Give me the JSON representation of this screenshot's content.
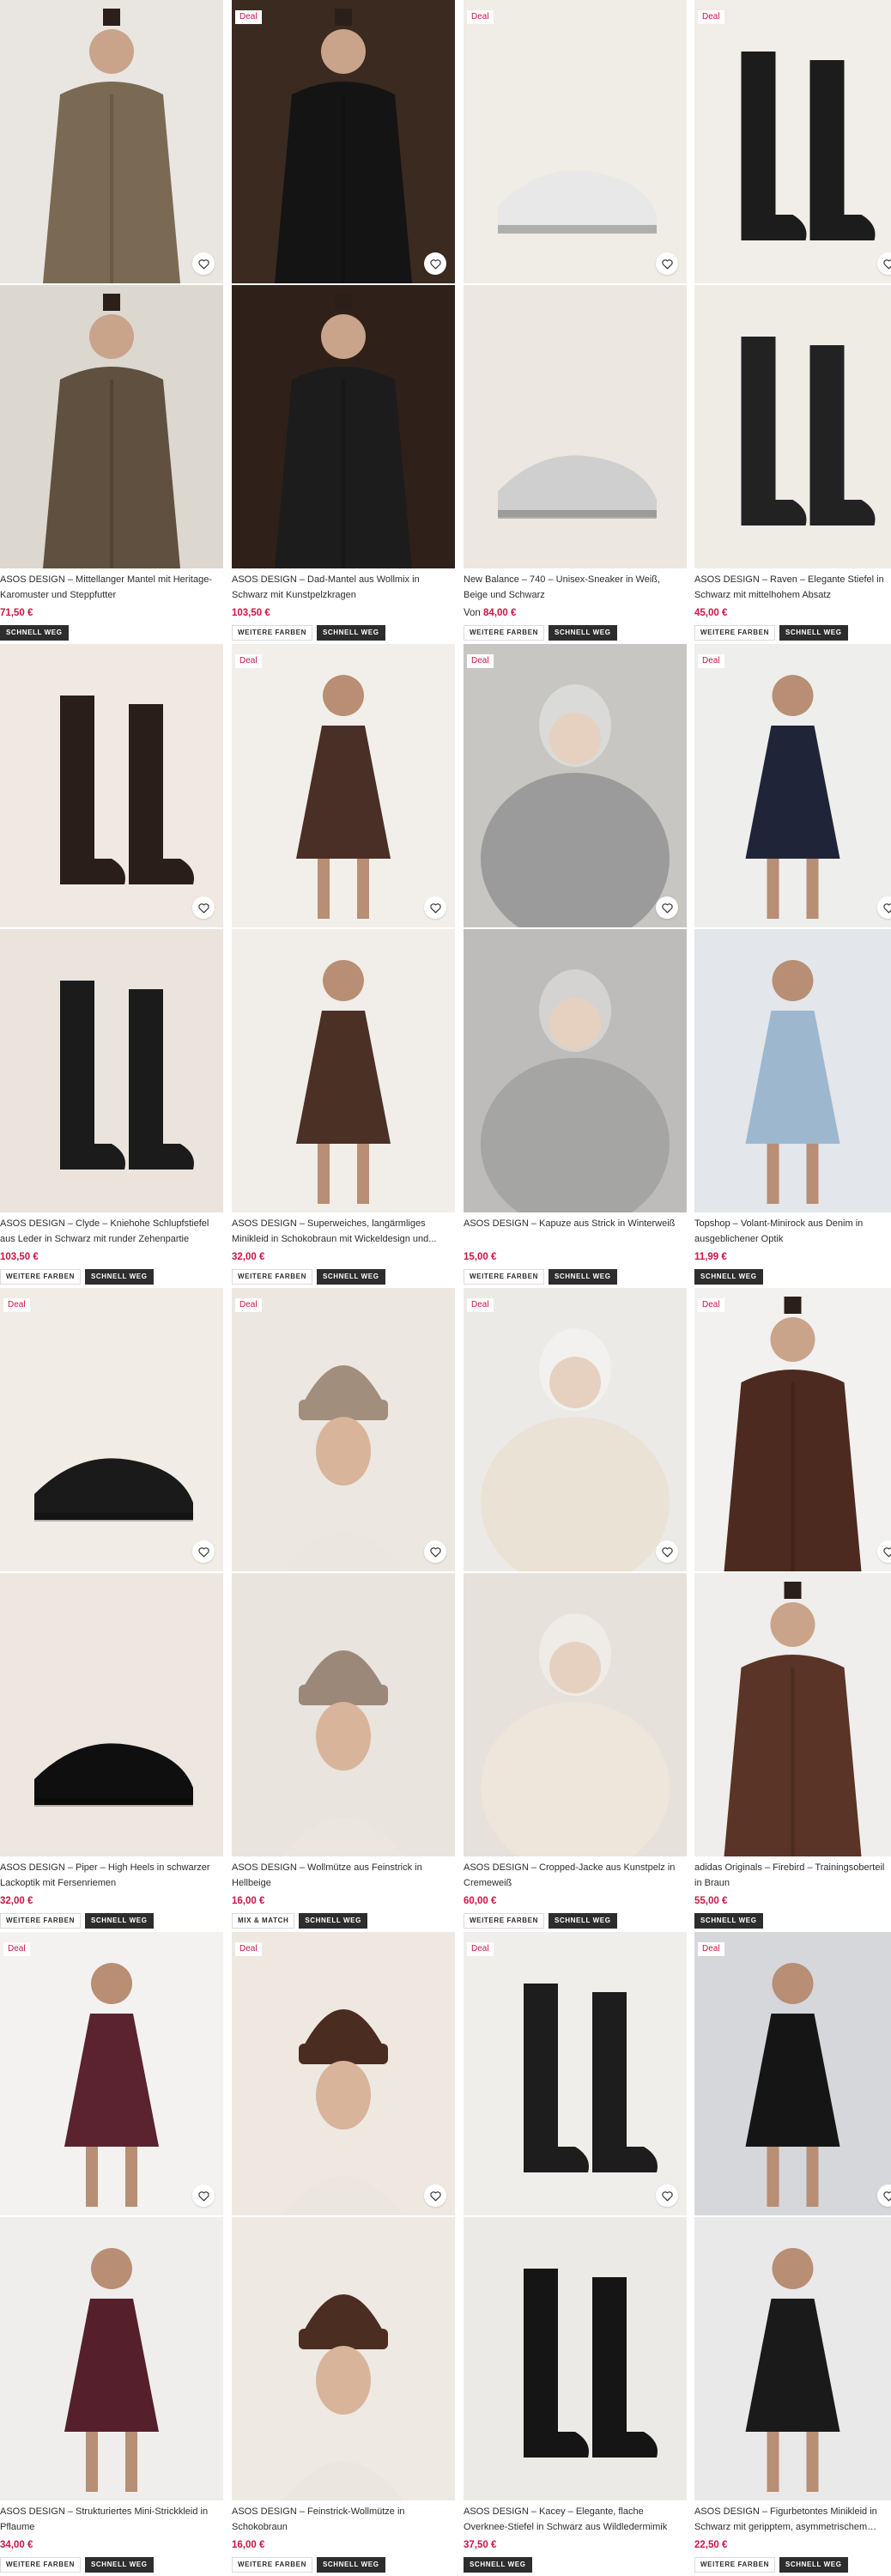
{
  "colors": {
    "deal": "#d01345",
    "price": "#d01345",
    "tag_dark": "#2d2d2d"
  },
  "products": [
    {
      "title": "ASOS DESIGN – Mittellanger Mantel mit Heritage-Karomuster und Steppfutter",
      "price": "71,50 €",
      "price_prefix": "",
      "deal": "",
      "tags": [
        "SCHNELL WEG"
      ],
      "icon": "heart-icon"
    },
    {
      "title": "ASOS DESIGN – Dad-Mantel aus Wollmix in Schwarz mit Kunstpelzkragen",
      "price": "103,50 €",
      "price_prefix": "",
      "deal": "Deal",
      "tags": [
        "WEITERE FARBEN",
        "SCHNELL WEG"
      ],
      "icon": "heart-icon"
    },
    {
      "title": "New Balance – 740 – Unisex-Sneaker in Weiß, Beige und Schwarz",
      "price": "84,00 €",
      "price_prefix": "Von",
      "deal": "Deal",
      "tags": [
        "WEITERE FARBEN",
        "SCHNELL WEG"
      ],
      "icon": "heart-icon"
    },
    {
      "title": "ASOS DESIGN – Raven – Elegante Stiefel in Schwarz mit mittelhohem Absatz",
      "price": "45,00 €",
      "price_prefix": "",
      "deal": "Deal",
      "tags": [
        "WEITERE FARBEN",
        "SCHNELL WEG"
      ],
      "icon": "heart-icon"
    },
    {
      "title": "ASOS DESIGN – Clyde – Kniehohe Schlupfstiefel aus Leder in Schwarz mit runder Zehenpartie",
      "price": "103,50 €",
      "price_prefix": "",
      "deal": "",
      "tags": [
        "WEITERE FARBEN",
        "SCHNELL WEG"
      ],
      "icon": "heart-icon"
    },
    {
      "title": "ASOS DESIGN – Superweiches, langärmliges Minikleid in Schokobraun mit Wickeldesign und...",
      "price": "32,00 €",
      "price_prefix": "",
      "deal": "Deal",
      "tags": [
        "WEITERE FARBEN",
        "SCHNELL WEG"
      ],
      "icon": "heart-icon"
    },
    {
      "title": "ASOS DESIGN – Kapuze aus Strick in Winterweiß",
      "price": "15,00 €",
      "price_prefix": "",
      "deal": "Deal",
      "tags": [
        "WEITERE FARBEN",
        "SCHNELL WEG"
      ],
      "icon": "heart-icon"
    },
    {
      "title": "Topshop – Volant-Minirock aus Denim in ausgeblichener Optik",
      "price": "11,99 €",
      "price_prefix": "",
      "deal": "Deal",
      "tags": [
        "SCHNELL WEG"
      ],
      "icon": "heart-icon"
    },
    {
      "title": "ASOS DESIGN – Piper – High Heels in schwarzer Lackoptik mit Fersenriemen",
      "price": "32,00 €",
      "price_prefix": "",
      "deal": "Deal",
      "tags": [
        "WEITERE FARBEN",
        "SCHNELL WEG"
      ],
      "icon": "heart-icon"
    },
    {
      "title": "ASOS DESIGN – Wollmütze aus Feinstrick in Hellbeige",
      "price": "16,00 €",
      "price_prefix": "",
      "deal": "Deal",
      "tags": [
        "MIX & MATCH",
        "SCHNELL WEG"
      ],
      "icon": "heart-icon"
    },
    {
      "title": "ASOS DESIGN – Cropped-Jacke aus Kunstpelz in Cremeweiß",
      "price": "60,00 €",
      "price_prefix": "",
      "deal": "Deal",
      "tags": [
        "WEITERE FARBEN",
        "SCHNELL WEG"
      ],
      "icon": "heart-icon"
    },
    {
      "title": "adidas Originals – Firebird – Trainingsoberteil in Braun",
      "price": "55,00 €",
      "price_prefix": "",
      "deal": "Deal",
      "tags": [
        "SCHNELL WEG"
      ],
      "icon": "heart-icon"
    },
    {
      "title": "ASOS DESIGN – Strukturiertes Mini-Strickkleid in Pflaume",
      "price": "34,00 €",
      "price_prefix": "",
      "deal": "Deal",
      "tags": [
        "WEITERE FARBEN",
        "SCHNELL WEG"
      ],
      "icon": "heart-icon"
    },
    {
      "title": "ASOS DESIGN – Feinstrick-Wollmütze in Schokobraun",
      "price": "16,00 €",
      "price_prefix": "",
      "deal": "Deal",
      "tags": [
        "WEITERE FARBEN",
        "SCHNELL WEG"
      ],
      "icon": "heart-icon"
    },
    {
      "title": "ASOS DESIGN – Kacey – Elegante, flache Overknee-Stiefel in Schwarz aus Wildledermimik",
      "price": "37,50 €",
      "price_prefix": "",
      "deal": "Deal",
      "tags": [
        "SCHNELL WEG"
      ],
      "icon": "heart-icon"
    },
    {
      "title": "ASOS DESIGN – Figurbetontes Minikleid in Schwarz mit geripptem, asymmetrischem Ausschnitt",
      "price": "22,50 €",
      "price_prefix": "",
      "deal": "Deal",
      "tags": [
        "WEITERE FARBEN",
        "SCHNELL WEG"
      ],
      "icon": "heart-icon"
    }
  ]
}
